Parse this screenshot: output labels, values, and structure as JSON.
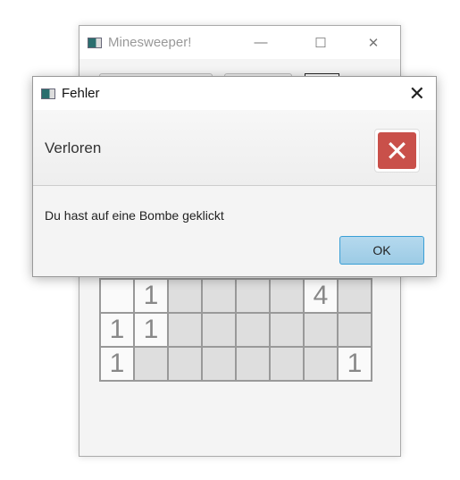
{
  "main_window": {
    "title": "Minesweeper!",
    "minimize": "—",
    "maximize": "☐",
    "close": "✕",
    "grid": [
      [
        "",
        "1",
        "",
        "",
        "",
        "",
        "4",
        ""
      ],
      [
        "1",
        "1",
        "",
        "",
        "",
        "",
        "",
        ""
      ],
      [
        "1",
        "",
        "",
        "",
        "",
        "",
        "",
        "1"
      ]
    ],
    "open": [
      [
        true,
        true,
        false,
        false,
        false,
        false,
        true,
        false
      ],
      [
        true,
        true,
        false,
        false,
        false,
        false,
        false,
        false
      ],
      [
        true,
        false,
        false,
        false,
        false,
        false,
        false,
        true
      ]
    ]
  },
  "dialog": {
    "title": "Fehler",
    "close": "✕",
    "header": "Verloren",
    "icon": "error-x-icon",
    "icon_glyph": "✕",
    "content": "Du hast auf eine Bombe geklickt",
    "ok_label": "OK"
  }
}
